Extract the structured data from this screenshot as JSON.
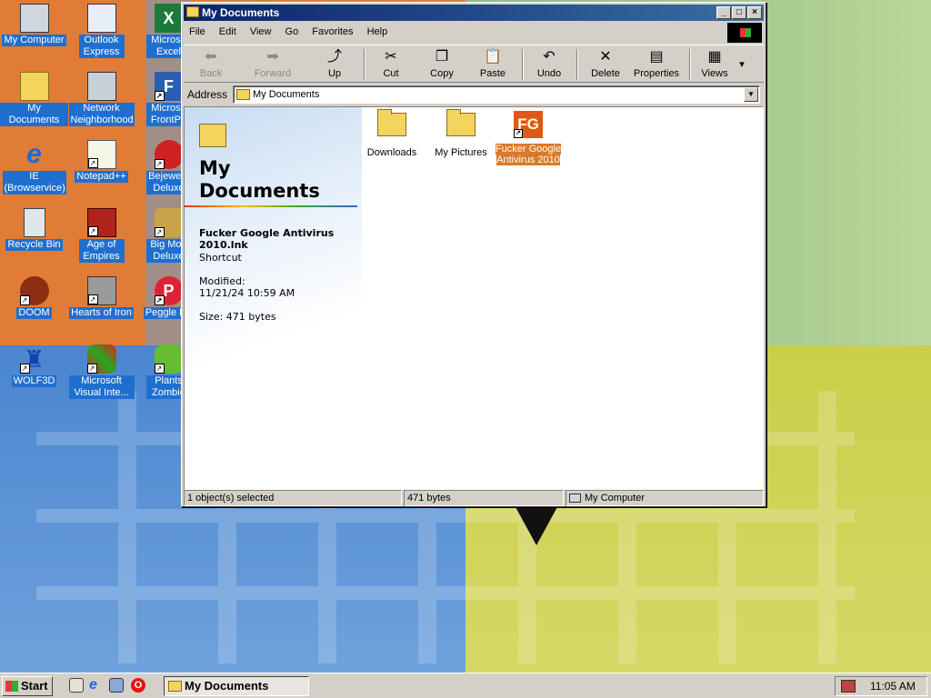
{
  "desktop": {
    "icons": [
      {
        "label": "My Computer",
        "glyph": "🖥"
      },
      {
        "label": "My Documents",
        "glyph": "📁"
      },
      {
        "label": "IE (Browservice)",
        "glyph": "e"
      },
      {
        "label": "Recycle Bin",
        "glyph": "🗑"
      },
      {
        "label": "DOOM",
        "glyph": "☠"
      },
      {
        "label": "WOLF3D",
        "glyph": "♜"
      },
      {
        "label": "Outlook Express",
        "glyph": "✉"
      },
      {
        "label": "Network Neighborhood",
        "glyph": "🖧"
      },
      {
        "label": "Notepad++",
        "glyph": "✎"
      },
      {
        "label": "Age of Empires",
        "glyph": "⚔"
      },
      {
        "label": "Hearts of Iron",
        "glyph": "✈"
      },
      {
        "label": "Microsoft Visual Inte...",
        "glyph": "◆"
      },
      {
        "label": "Microso Excel",
        "glyph": "X"
      },
      {
        "label": "Microso FrontPa",
        "glyph": "F"
      },
      {
        "label": "Bejewele Deluxe",
        "glyph": "♦"
      },
      {
        "label": "Big Mon Deluxe",
        "glyph": "♞"
      },
      {
        "label": "Peggle De",
        "glyph": "P"
      },
      {
        "label": "Plants Zombie",
        "glyph": "✿"
      }
    ]
  },
  "window": {
    "title": "My Documents",
    "menu": [
      "File",
      "Edit",
      "View",
      "Go",
      "Favorites",
      "Help"
    ],
    "toolbar": {
      "back": "Back",
      "forward": "Forward",
      "up": "Up",
      "cut": "Cut",
      "copy": "Copy",
      "paste": "Paste",
      "undo": "Undo",
      "delete": "Delete",
      "properties": "Properties",
      "views": "Views"
    },
    "address": {
      "label": "Address",
      "value": "My Documents"
    },
    "webview": {
      "title_line1": "My",
      "title_line2": "Documents",
      "selected_name": "Fucker Google Antivirus 2010.lnk",
      "selected_type": "Shortcut",
      "modified_label": "Modified:",
      "modified_value": "11/21/24 10:59 AM",
      "size": "Size: 471 bytes"
    },
    "files": [
      {
        "label": "Downloads"
      },
      {
        "label": "My Pictures"
      },
      {
        "label": "Fucker Google Antivirus 2010",
        "glyph": "FG"
      }
    ],
    "status": {
      "selection": "1 object(s) selected",
      "size": "471 bytes",
      "zone": "My Computer"
    }
  },
  "taskbar": {
    "start_label": "Start",
    "task_label": "My Documents",
    "clock": "11:05 AM"
  },
  "colors": {
    "titlebar": "#0a246a",
    "selection": "#d97a2a",
    "desktop_label_bg": "#1f6fd0"
  }
}
